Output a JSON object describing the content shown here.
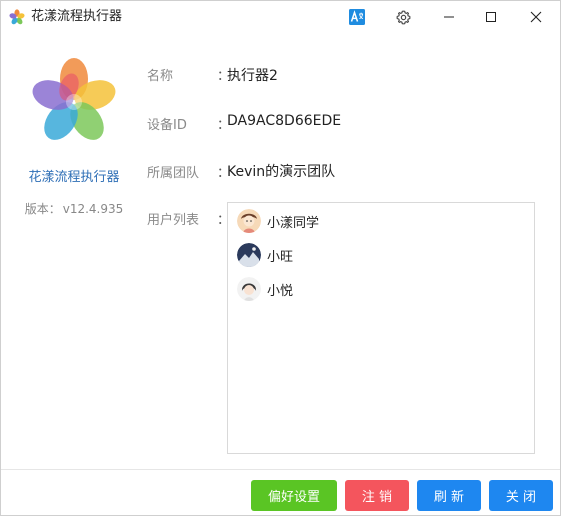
{
  "window": {
    "title": "花漾流程执行器",
    "controls": {
      "translate_icon": "translate-icon",
      "settings_icon": "gear-icon",
      "minimize_icon": "minimize-icon",
      "maximize_icon": "maximize-icon",
      "close_icon": "close-icon"
    }
  },
  "app": {
    "name": "花漾流程执行器",
    "version_label": "版本：",
    "version": "v12.4.935"
  },
  "info": {
    "colon": "：",
    "name_label": "名称",
    "name_value": "执行器2",
    "device_label": "设备ID",
    "device_value": "DA9AC8D66EDE",
    "team_label": "所属团队",
    "team_value": "Kevin的演示团队",
    "users_label": "用户列表"
  },
  "users": [
    {
      "name": "小漾同学"
    },
    {
      "name": "小旺"
    },
    {
      "name": "小悦"
    }
  ],
  "footer": {
    "preferences": "偏好设置",
    "logout": "注 销",
    "refresh": "刷 新",
    "close": "关 闭"
  },
  "colors": {
    "preferences": "#5ac524",
    "logout": "#f4555d",
    "refresh": "#1e87f0",
    "close": "#1e87f0",
    "app_name": "#2f6fb6"
  }
}
